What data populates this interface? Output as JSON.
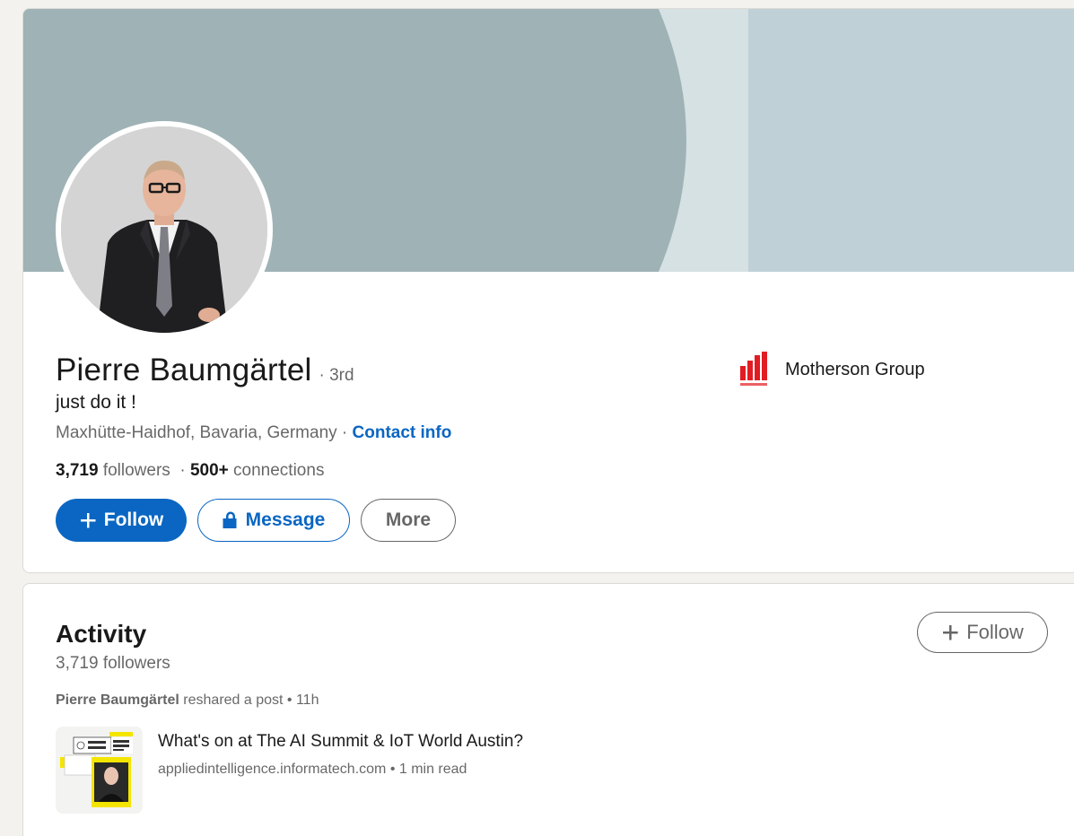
{
  "profile": {
    "name": "Pierre Baumgärtel",
    "degree": "· 3rd",
    "headline": "just do it !",
    "location": "Maxhütte-Haidhof, Bavaria, Germany",
    "location_sep": " · ",
    "contact_info": "Contact info",
    "followers_count": "3,719",
    "followers_label": " followers",
    "connections_sep": "  · ",
    "connections_count": "500+",
    "connections_label": " connections",
    "avatar_icon": "person-photo"
  },
  "actions": {
    "follow_label": "Follow",
    "message_label": "Message",
    "more_label": "More",
    "follow_icon": "plus-icon",
    "message_icon": "lock-icon"
  },
  "company": {
    "name": "Motherson Group",
    "logo_icon": "motherson-logo",
    "logo_color": "#e21c23"
  },
  "activity": {
    "title": "Activity",
    "followers": "3,719 followers",
    "follow_label": "Follow",
    "reshare_author": "Pierre Baumgärtel",
    "reshare_text": " reshared a post • 11h",
    "post": {
      "title": "What's on at The AI Summit & IoT World Austin?",
      "meta": "appliedintelligence.informatech.com • 1 min read"
    }
  },
  "colors": {
    "brand_blue": "#0a66c2",
    "banner": "#9fb2b6",
    "banner_light": "#bfd1d6",
    "page_bg": "#f4f2ee"
  }
}
